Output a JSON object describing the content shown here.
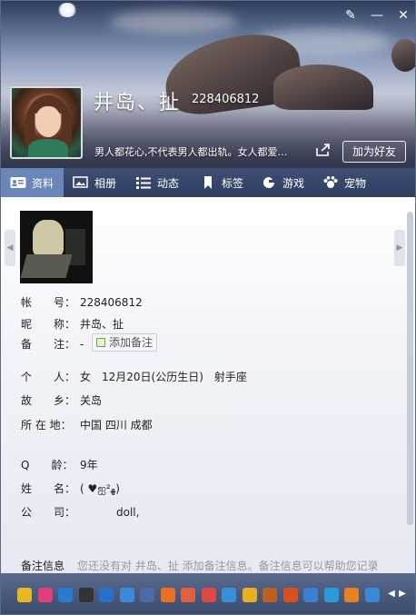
{
  "window": {
    "minimize": "—",
    "close": "✕",
    "skin": "✎"
  },
  "profile": {
    "nickname": "井岛、扯",
    "qq_number": "228406812",
    "signature": "男人都花心,不代表男人都出轨。女人都爱…",
    "add_friend_label": "加为好友"
  },
  "tabs": [
    {
      "label": "资料",
      "icon": "profile-card-icon",
      "active": true
    },
    {
      "label": "相册",
      "icon": "photo-album-icon",
      "active": false
    },
    {
      "label": "动态",
      "icon": "feed-list-icon",
      "active": false
    },
    {
      "label": "标签",
      "icon": "bookmark-icon",
      "active": false
    },
    {
      "label": "游戏",
      "icon": "game-icon",
      "active": false
    },
    {
      "label": "宠物",
      "icon": "pet-icon",
      "active": false
    }
  ],
  "info": {
    "account_label": "帐　　号：",
    "account_value": "228406812",
    "nickname_label": "昵　　称：",
    "nickname_value": "井岛、扯",
    "remark_label": "备　　注：",
    "remark_value": "-",
    "add_remark_label": "添加备注",
    "person_label": "个　　人：",
    "person_value": "女　12月20日(公历生日)　射手座",
    "hometown_label": "故　　乡：",
    "hometown_value": "关岛",
    "location_label": "所 在 地：",
    "location_value": "中国 四川 成都",
    "qage_label": "Q　　龄：",
    "qage_value": "9年",
    "name_label": "姓　　名：",
    "name_value": "( ♥ஐﻬ²)",
    "company_label": "公　　司：",
    "company_value": "doll,"
  },
  "remark_info": {
    "title": "备注信息",
    "text": "您还没有对 井岛、扯 添加备注信息。备注信息可以帮助您记录"
  },
  "taskbar": {
    "icons": [
      "star-icon",
      "app-store-icon",
      "qq-mail-icon",
      "penguin-icon",
      "security-shield-icon",
      "pai-icon",
      "mail-icon",
      "google-icon",
      "face-icon",
      "game-cube-icon",
      "kite-icon",
      "wallet-icon",
      "cartoon-icon",
      "pet-face-icon",
      "phone-icon",
      "qq-music-icon",
      "fox-icon",
      "cloud-drive-icon"
    ],
    "colors": [
      "#e8b820",
      "#e0407a",
      "#2a7ad0",
      "#333333",
      "#2a70c8",
      "#3a8ad8",
      "#4a6aa8",
      "#e87020",
      "#e06040",
      "#e04848",
      "#3a90d8",
      "#e8b020",
      "#c06020",
      "#d85020",
      "#3a80d0",
      "#2a9ad8",
      "#e88020",
      "#3a88d8"
    ]
  }
}
